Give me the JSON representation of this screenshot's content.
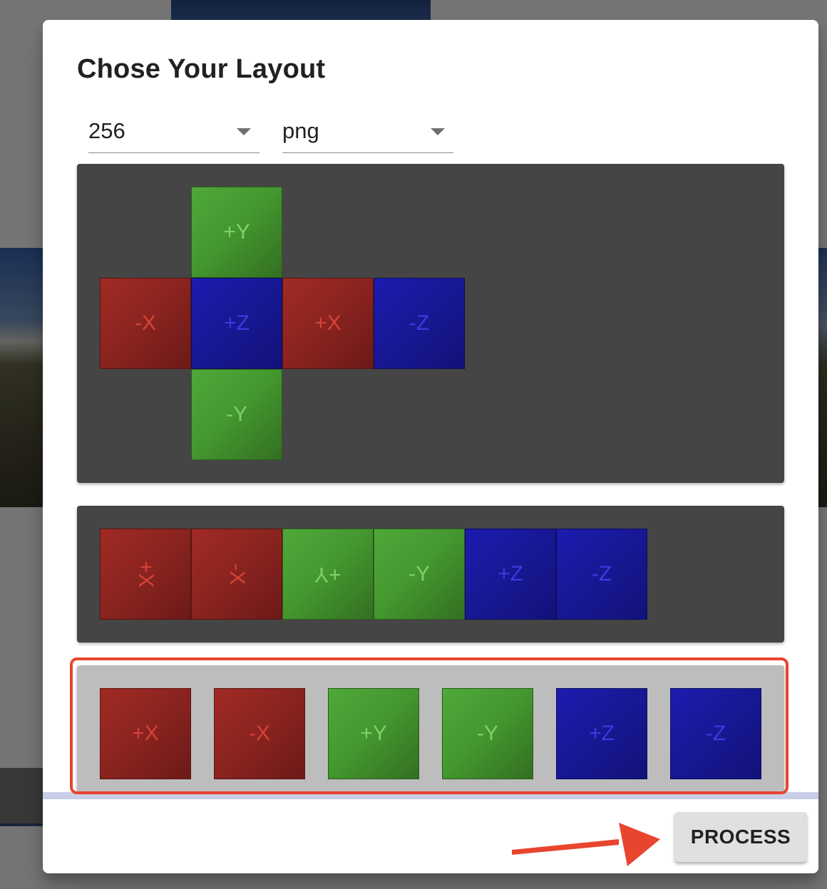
{
  "dialog": {
    "title": "Chose Your Layout",
    "size_select": {
      "value": "256"
    },
    "format_select": {
      "value": "png"
    },
    "process_label": "PROCESS"
  },
  "layouts": {
    "cross": {
      "faces": [
        {
          "label": "+Y",
          "color": "green"
        },
        {
          "label": "-X",
          "color": "red"
        },
        {
          "label": "+Z",
          "color": "blue"
        },
        {
          "label": "+X",
          "color": "red"
        },
        {
          "label": "-Z",
          "color": "blue"
        },
        {
          "label": "-Y",
          "color": "green"
        }
      ]
    },
    "strip": {
      "faces": [
        {
          "label": "+X",
          "color": "red",
          "orientation": "rotated 90"
        },
        {
          "label": "-X",
          "color": "red",
          "orientation": "rotated 90"
        },
        {
          "label": "+Y",
          "color": "green",
          "orientation": "upside down"
        },
        {
          "label": "-Y",
          "color": "green",
          "orientation": "upright"
        },
        {
          "label": "+Z",
          "color": "blue",
          "orientation": "upright"
        },
        {
          "label": "-Z",
          "color": "blue",
          "orientation": "upright"
        }
      ]
    },
    "separate": {
      "selected": true,
      "faces": [
        {
          "label": "+X",
          "color": "red"
        },
        {
          "label": "-X",
          "color": "red"
        },
        {
          "label": "+Y",
          "color": "green"
        },
        {
          "label": "-Y",
          "color": "green"
        },
        {
          "label": "+Z",
          "color": "blue"
        },
        {
          "label": "-Z",
          "color": "blue"
        }
      ]
    }
  },
  "colors": {
    "red": "#8c2420",
    "green": "#45992f",
    "blue": "#181896",
    "highlight": "#e8452f",
    "annotation_arrow": "#e8452f"
  }
}
